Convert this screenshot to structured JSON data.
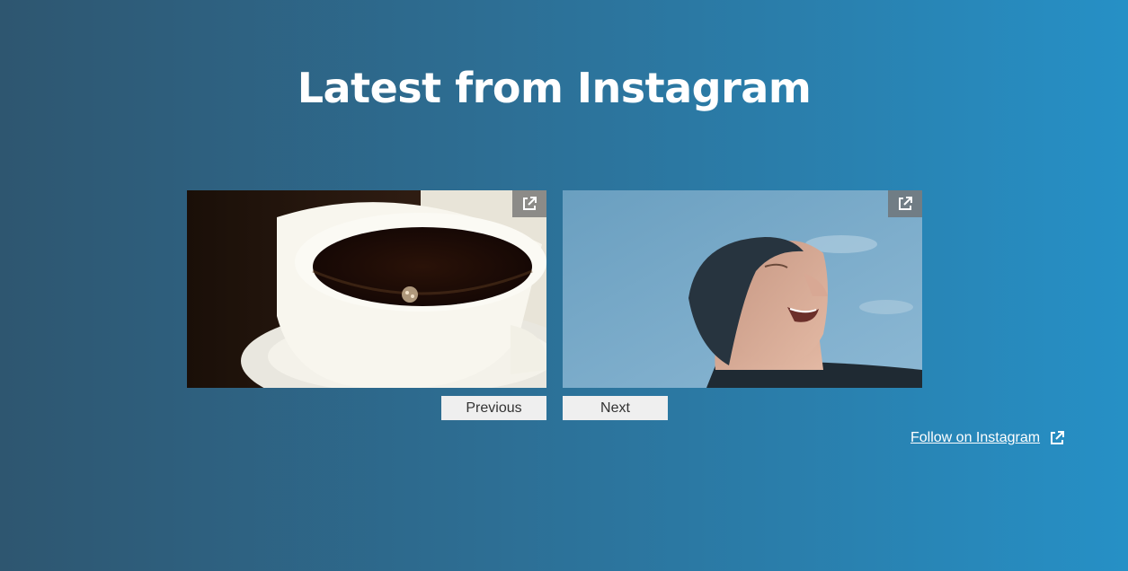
{
  "section": {
    "title": "Latest from Instagram"
  },
  "carousel": {
    "posts": [
      {
        "image": "coffee-cup-photo",
        "link_icon": "external-link-icon"
      },
      {
        "image": "man-sky-portrait-photo",
        "link_icon": "external-link-icon"
      }
    ],
    "previous_label": "Previous",
    "next_label": "Next"
  },
  "follow": {
    "label": "Follow on Instagram",
    "icon": "external-link-icon"
  },
  "colors": {
    "gradient_start": "#2e5670",
    "gradient_end": "#2690c6",
    "button_bg": "#efefef",
    "button_text": "#333333"
  }
}
